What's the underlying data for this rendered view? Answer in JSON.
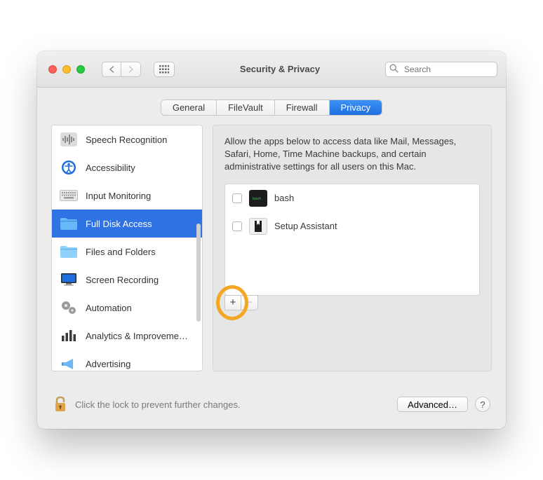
{
  "window": {
    "title": "Security & Privacy"
  },
  "search": {
    "placeholder": "Search"
  },
  "tabs": [
    {
      "label": "General",
      "active": false
    },
    {
      "label": "FileVault",
      "active": false
    },
    {
      "label": "Firewall",
      "active": false
    },
    {
      "label": "Privacy",
      "active": true
    }
  ],
  "sidebar": {
    "items": [
      {
        "label": "Speech Recognition",
        "icon": "waveform",
        "selected": false
      },
      {
        "label": "Accessibility",
        "icon": "accessibility",
        "selected": false
      },
      {
        "label": "Input Monitoring",
        "icon": "keyboard",
        "selected": false
      },
      {
        "label": "Full Disk Access",
        "icon": "folder-blue",
        "selected": true
      },
      {
        "label": "Files and Folders",
        "icon": "folder-light",
        "selected": false
      },
      {
        "label": "Screen Recording",
        "icon": "display",
        "selected": false
      },
      {
        "label": "Automation",
        "icon": "gears",
        "selected": false
      },
      {
        "label": "Analytics & Improveme…",
        "icon": "bars",
        "selected": false
      },
      {
        "label": "Advertising",
        "icon": "megaphone",
        "selected": false
      }
    ]
  },
  "right": {
    "description": "Allow the apps below to access data like Mail, Messages, Safari, Home, Time Machine backups, and certain administrative settings for all users on this Mac.",
    "apps": [
      {
        "name": "bash",
        "checked": false,
        "icon": "terminal"
      },
      {
        "name": "Setup Assistant",
        "checked": false,
        "icon": "tux"
      }
    ],
    "add_label": "+",
    "remove_label": "−"
  },
  "bottom": {
    "lock_text": "Click the lock to prevent further changes.",
    "advanced_label": "Advanced…",
    "help_label": "?"
  }
}
